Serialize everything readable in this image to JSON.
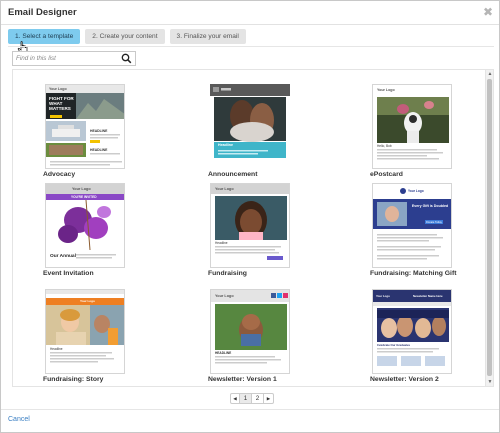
{
  "dialog": {
    "title": "Email Designer",
    "close_glyph": "✖"
  },
  "steps": [
    {
      "label": "1. Select a template"
    },
    {
      "label": "2. Create your content"
    },
    {
      "label": "3. Finalize your email"
    }
  ],
  "search": {
    "placeholder": "Find in this list",
    "icon": "search-icon"
  },
  "templates": [
    {
      "label": "Advocacy",
      "thumb": {
        "logo": "Your Logo",
        "headline": "FIGHT FOR WHAT MATTERS",
        "sub1": "HEADLINE",
        "sub2": "HEADLINE"
      }
    },
    {
      "label": "Announcement",
      "thumb": {
        "headline": "Headline"
      }
    },
    {
      "label": "ePostcard",
      "thumb": {
        "logo": "Your Logo",
        "caption": "Hello, Bob"
      }
    },
    {
      "label": "Event Invitation",
      "thumb": {
        "logo": "Your Logo",
        "banner": "YOU'RE INVITED",
        "caption": "Our Annual"
      }
    },
    {
      "label": "Fundraising",
      "thumb": {
        "logo": "Your Logo",
        "caption": "Headline"
      }
    },
    {
      "label": "Fundraising: Matching Gift",
      "thumb": {
        "logo": "Your Logo",
        "headline": "Every Gift is Doubled",
        "button": "Donate Today"
      }
    },
    {
      "label": "Fundraising: Story",
      "thumb": {
        "logo": "Your Logo",
        "caption": "Headline"
      }
    },
    {
      "label": "Newsletter: Version 1",
      "thumb": {
        "logo": "Your Logo",
        "caption": "HEADLINE"
      }
    },
    {
      "label": "Newsletter: Version 2",
      "thumb": {
        "logo": "Your Logo",
        "title": "Newsletter Name Here",
        "caption": "Celebrate Our Graduates"
      }
    }
  ],
  "pagination": {
    "prev": "◀",
    "pages": [
      "1",
      "2"
    ],
    "current": "1",
    "next": "▶"
  },
  "footer": {
    "cancel_label": "Cancel"
  },
  "colors": {
    "active_step": "#7ecbee",
    "link": "#3a7fc3",
    "announcement_teal": "#3fb5c9",
    "event_purple": "#8a48c6",
    "matching_navy": "#2c3e8f",
    "story_orange": "#ee7f22",
    "newsletter_navy": "#2a3470"
  }
}
